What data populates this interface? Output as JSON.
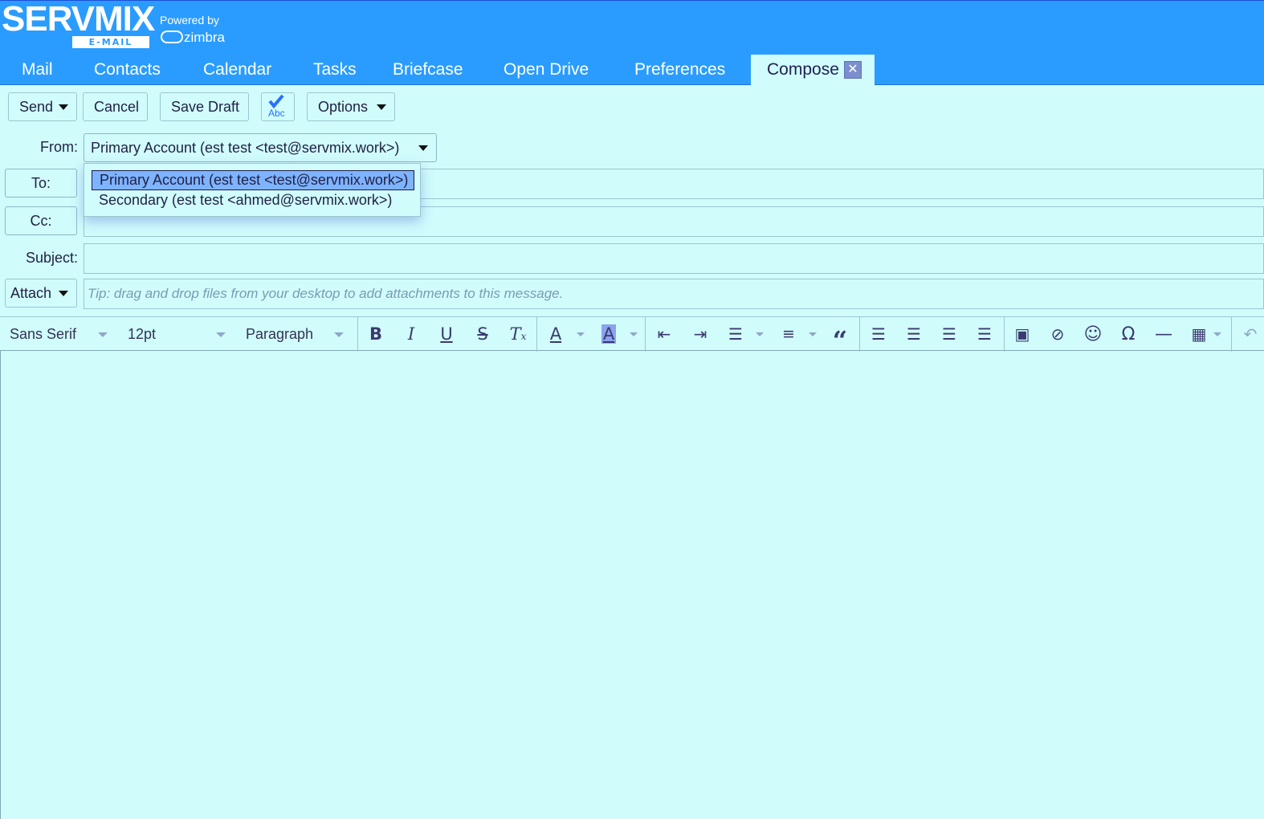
{
  "brand": {
    "logo_text": "SERVMIX",
    "logo_tag": "E-MAIL",
    "powered_by": "Powered by",
    "zimbra": "zimbra"
  },
  "tabs": [
    {
      "label": "Mail"
    },
    {
      "label": "Contacts"
    },
    {
      "label": "Calendar"
    },
    {
      "label": "Tasks"
    },
    {
      "label": "Briefcase"
    },
    {
      "label": "Open Drive"
    },
    {
      "label": "Preferences"
    },
    {
      "label": "Compose",
      "active": true
    }
  ],
  "toolbar": {
    "send": "Send",
    "cancel": "Cancel",
    "save_draft": "Save Draft",
    "spellcheck": "Abc",
    "options": "Options"
  },
  "form": {
    "from_label": "From:",
    "from_value": "Primary Account (est test <test@servmix.work>)",
    "from_options": [
      "Primary Account (est test <test@servmix.work>)",
      "Secondary (est test <ahmed@servmix.work>)"
    ],
    "to_label": "To:",
    "cc_label": "Cc:",
    "subject_label": "Subject:",
    "attach_label": "Attach",
    "attach_hint": "Tip: drag and drop files from your desktop to add attachments to this message."
  },
  "editor": {
    "font_family": "Sans Serif",
    "font_size": "12pt",
    "block_format": "Paragraph"
  },
  "colors": {
    "header_bg": "#2a9cff",
    "page_bg": "#d0fcfc",
    "selected_option_bg": "#7eb3ff"
  }
}
